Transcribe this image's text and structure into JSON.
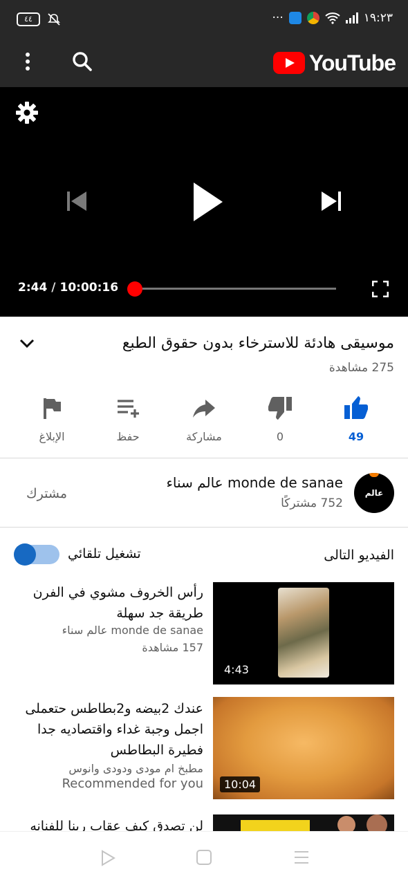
{
  "status_bar": {
    "battery": "٤٤",
    "time": "١٩:٢٣",
    "more": "···"
  },
  "app_bar": {
    "logo_text": "YouTube",
    "colors": {
      "logo_red": "#ff0000",
      "bar_bg": "#282828"
    }
  },
  "player": {
    "current_time": "2:44",
    "separator": "/",
    "duration": "10:00:16",
    "progress_fraction": 0.0046,
    "colors": {
      "scrubber": "#ff0000"
    }
  },
  "video": {
    "title": "موسيقى هادئة للاسترخاء بدون حقوق الطبع",
    "views": "275 مشاهدة"
  },
  "actions": {
    "like_count": "49",
    "dislike_count": "0",
    "share_label": "مشاركة",
    "save_label": "حفظ",
    "report_label": "الإبلاغ",
    "colors": {
      "liked": "#065fd4"
    }
  },
  "channel": {
    "avatar_text": "عالم سناء",
    "name": "monde de sanae عالم سناء",
    "subscribers": "752 مشتركًا",
    "subscribed_label": "مشترك"
  },
  "up_next": {
    "heading": "الفيديو التالى",
    "autoplay_label": "تشغيل تلقائي",
    "autoplay_on": true,
    "items": [
      {
        "title": "رأس الخروف مشوي في الفرن طريقة جد سهلة",
        "meta1": "monde de sanae عالم سناء",
        "meta2": "157 مشاهدة",
        "duration": "4:43"
      },
      {
        "title": "عندك 2بيضه و2بطاطس حتعملى اجمل وجبة غداء واقتصاديه جدا فطيرة البطاطس",
        "meta1": "مطبخ ام مودى ودودى وانوس",
        "meta2": "Recommended for you",
        "duration": "10:04"
      },
      {
        "title": "لن تصدق كيف عقاب ربنا للفنانه"
      }
    ]
  }
}
